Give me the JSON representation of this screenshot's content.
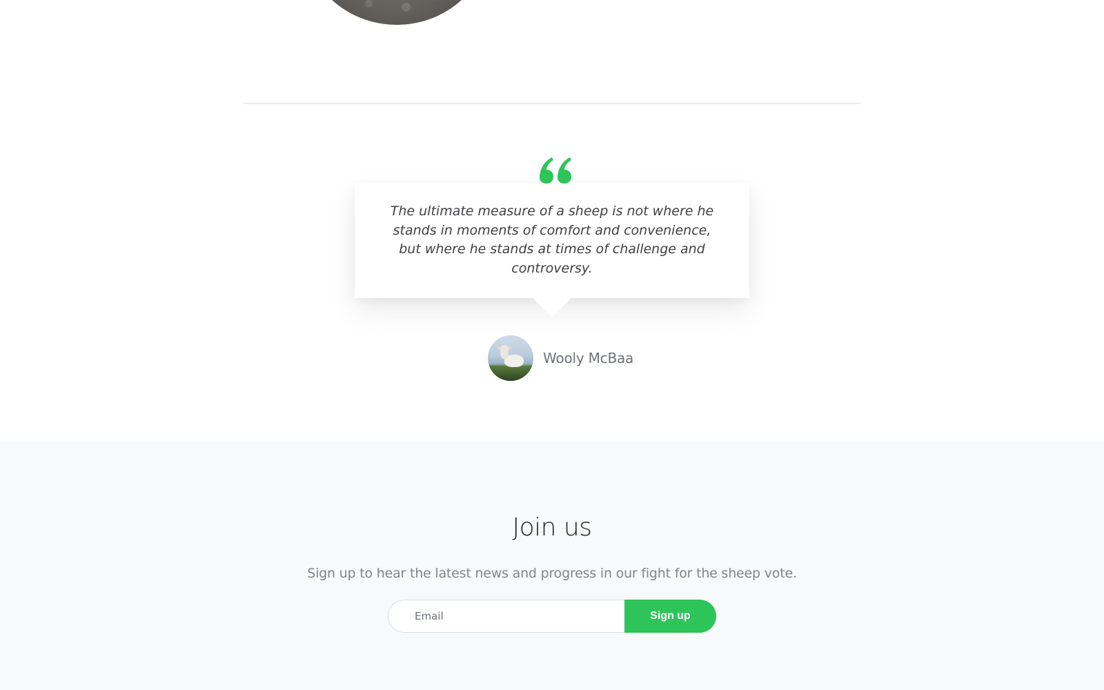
{
  "hero": {
    "photo_icon": "sheep-photo"
  },
  "testimonial": {
    "quote_icon": "quote-mark-icon",
    "quote_color": "#2dc45a",
    "text": "The ultimate measure of a sheep is not where he stands in moments of comfort and convenience, but where he stands at times of challenge and controversy.",
    "author_name": "Wooly McBaa",
    "avatar_icon": "sheep-avatar"
  },
  "join": {
    "title": "Join us",
    "subtitle": "Sign up to hear the latest news and progress in our fight for the sheep vote.",
    "email_placeholder": "Email",
    "email_value": "",
    "button_label": "Sign up",
    "button_color": "#2dc45a",
    "background_color": "#f8f9fb"
  }
}
